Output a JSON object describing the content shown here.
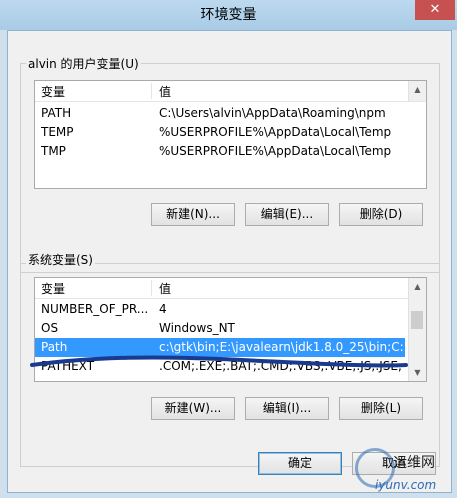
{
  "window": {
    "title": "环境变量",
    "close_glyph": "✕"
  },
  "user_vars": {
    "label": "alvin 的用户变量(U)",
    "columns": [
      "变量",
      "值"
    ],
    "rows": [
      {
        "name": "PATH",
        "value": "C:\\Users\\alvin\\AppData\\Roaming\\npm"
      },
      {
        "name": "TEMP",
        "value": "%USERPROFILE%\\AppData\\Local\\Temp"
      },
      {
        "name": "TMP",
        "value": "%USERPROFILE%\\AppData\\Local\\Temp"
      }
    ],
    "buttons": {
      "new": "新建(N)...",
      "edit": "编辑(E)...",
      "delete": "删除(D)"
    }
  },
  "system_vars": {
    "label": "系统变量(S)",
    "columns": [
      "变量",
      "值"
    ],
    "rows": [
      {
        "name": "NUMBER_OF_PR...",
        "value": "4"
      },
      {
        "name": "OS",
        "value": "Windows_NT"
      },
      {
        "name": "Path",
        "value": "c:\\gtk\\bin;E:\\javalearn\\jdk1.8.0_25\\bin;C:...",
        "selected": true
      },
      {
        "name": "PATHEXT",
        "value": ".COM;.EXE;.BAT;.CMD;.VBS;.VBE;.JS;.JSE;..."
      }
    ],
    "buttons": {
      "new": "新建(W)...",
      "edit": "编辑(I)...",
      "delete": "删除(L)"
    }
  },
  "dialog_buttons": {
    "ok": "确定",
    "cancel": "取消"
  },
  "colors": {
    "selection": "#3399ff",
    "annotation": "#1a3a8f",
    "close": "#c75050"
  },
  "watermark": {
    "title": "运维网",
    "sub": "iyunv.com"
  }
}
